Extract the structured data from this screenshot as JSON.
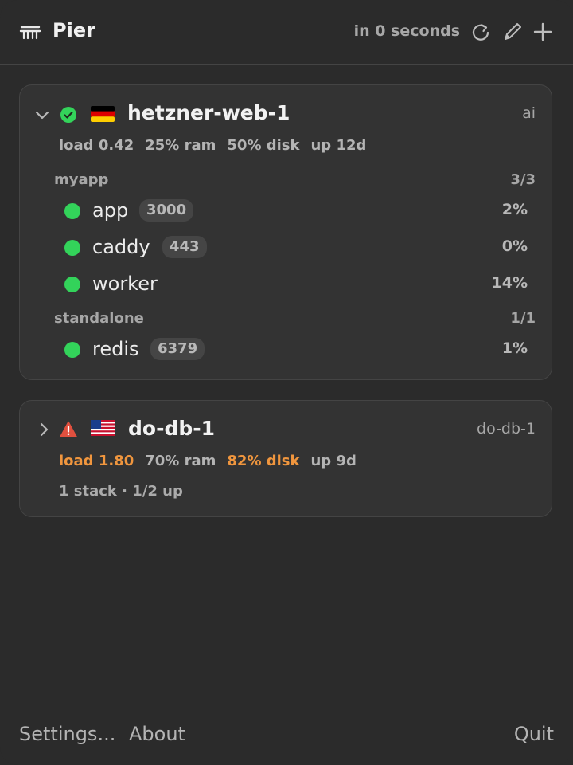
{
  "app": {
    "title": "Pier"
  },
  "header": {
    "refresh_status": "in 0 seconds"
  },
  "servers": [
    {
      "name": "hetzner-web-1",
      "tag": "ai",
      "status": "ok",
      "flag": "de",
      "expanded": true,
      "metrics": {
        "load": "load 0.42",
        "ram": "25% ram",
        "disk": "50% disk",
        "uptime": "up 12d"
      },
      "groups": [
        {
          "name": "myapp",
          "count": "3/3",
          "services": [
            {
              "name": "app",
              "port": "3000",
              "cpu": "2%"
            },
            {
              "name": "caddy",
              "port": "443",
              "cpu": "0%"
            },
            {
              "name": "worker",
              "port": "",
              "cpu": "14%"
            }
          ]
        },
        {
          "name": "standalone",
          "count": "1/1",
          "services": [
            {
              "name": "redis",
              "port": "6379",
              "cpu": "1%"
            }
          ]
        }
      ]
    },
    {
      "name": "do-db-1",
      "tag": "do-db-1",
      "status": "warning",
      "flag": "us",
      "expanded": false,
      "metrics": {
        "load": "load 1.80",
        "ram": "70% ram",
        "disk": "82% disk",
        "uptime": "up 9d"
      },
      "summary": "1 stack · 1/2 up"
    }
  ],
  "footer": {
    "settings": "Settings...",
    "about": "About",
    "quit": "Quit"
  },
  "colors": {
    "ok": "#33d35a",
    "warn": "#f0963e",
    "error": "#e0503f",
    "background": "#2b2b2b",
    "card": "#333333"
  }
}
